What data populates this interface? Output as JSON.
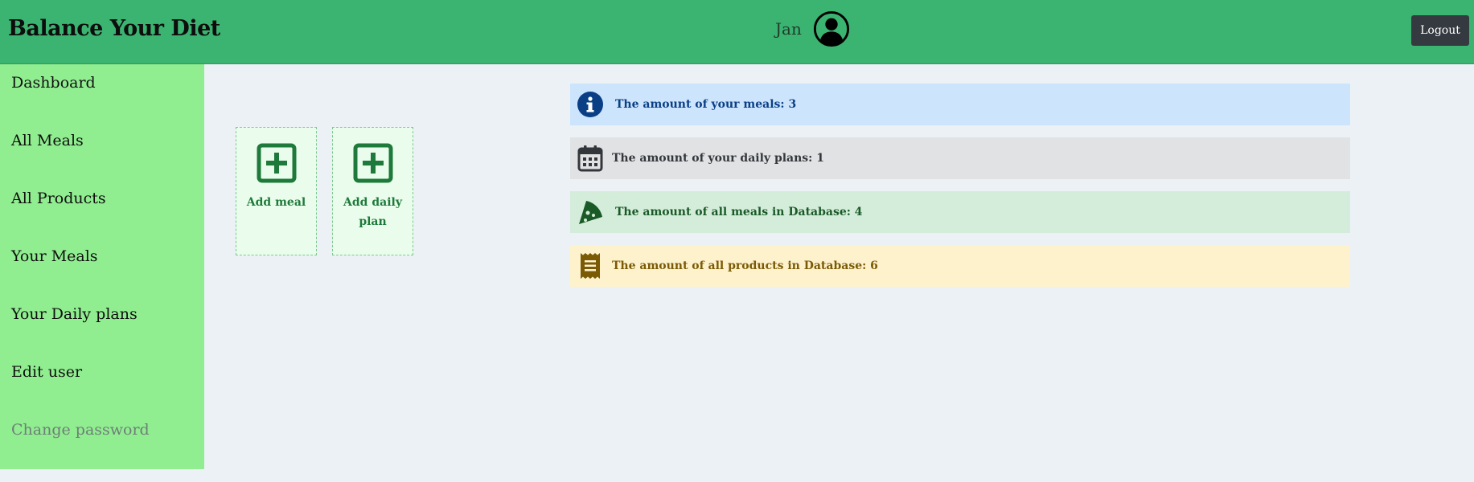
{
  "header": {
    "brand": "Balance Your Diet",
    "username": "Jan",
    "logout_label": "Logout"
  },
  "sidebar": {
    "items": [
      {
        "label": "Dashboard"
      },
      {
        "label": "All Meals"
      },
      {
        "label": "All Products"
      },
      {
        "label": "Your Meals"
      },
      {
        "label": "Your Daily plans"
      },
      {
        "label": "Edit user"
      },
      {
        "label": "Change password"
      }
    ]
  },
  "actions": {
    "add_meal_label": "Add meal",
    "add_daily_plan_label": "Add daily plan"
  },
  "stats": {
    "meals": "The amount of your meals: 3",
    "daily_plans": "The amount of your daily plans: 1",
    "db_meals": "The amount of all meals in Database: 4",
    "db_products": "The amount of all products in Database: 6"
  },
  "icons": {
    "avatar": "user-circle-icon",
    "add_meal": "plus-square-icon",
    "add_daily_plan": "plus-square-icon",
    "meals": "info-circle-icon",
    "daily_plans": "calendar-icon",
    "db_meals": "pizza-slice-icon",
    "db_products": "receipt-icon"
  },
  "colors": {
    "header_bg": "#3bb371",
    "sidebar_bg": "#90ee90",
    "page_bg": "#ecf1f6",
    "accent_green": "#1e7a3a",
    "info_bg": "#cce4fc",
    "secondary_bg": "#e1e2e4",
    "success_bg": "#d4edda",
    "warning_bg": "#fef2cc"
  }
}
